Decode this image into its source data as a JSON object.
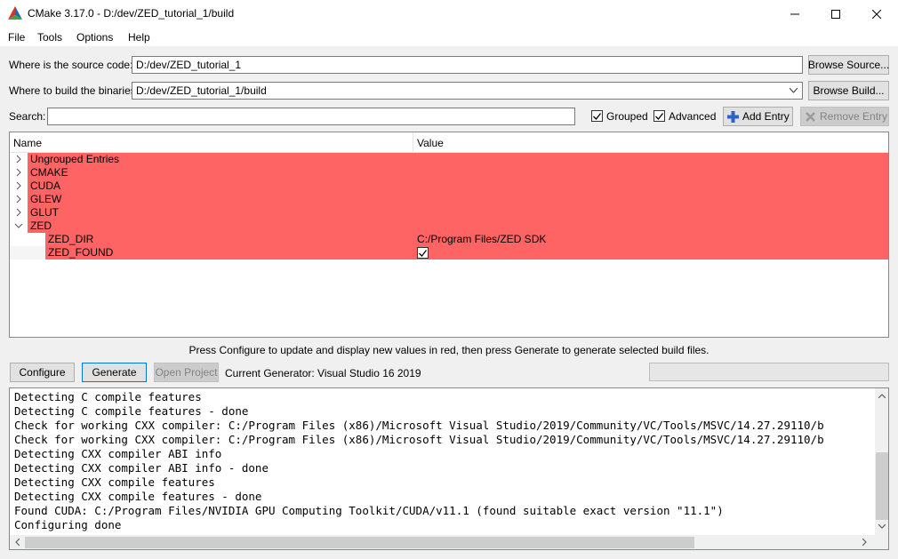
{
  "window": {
    "title": "CMake 3.17.0 - D:/dev/ZED_tutorial_1/build"
  },
  "menu": [
    "File",
    "Tools",
    "Options",
    "Help"
  ],
  "source": {
    "label": "Where is the source code:",
    "value": "D:/dev/ZED_tutorial_1",
    "browse": "Browse Source..."
  },
  "build": {
    "label": "Where to build the binaries:",
    "value": "D:/dev/ZED_tutorial_1/build",
    "browse": "Browse Build..."
  },
  "search": {
    "label": "Search:",
    "value": "",
    "grouped": "Grouped",
    "advanced": "Advanced",
    "add_entry": "Add Entry",
    "remove_entry": "Remove Entry"
  },
  "tree": {
    "col_name": "Name",
    "col_value": "Value",
    "groups": [
      "Ungrouped Entries",
      "CMAKE",
      "CUDA",
      "GLEW",
      "GLUT",
      "ZED"
    ],
    "zed_children": [
      {
        "name": "ZED_DIR",
        "value": "C:/Program Files/ZED SDK"
      },
      {
        "name": "ZED_FOUND",
        "value": ""
      }
    ]
  },
  "hint": "Press Configure to update and display new values in red, then press Generate to generate selected build files.",
  "actions": {
    "configure": "Configure",
    "generate": "Generate",
    "open_project": "Open Project",
    "generator": "Current Generator: Visual Studio 16 2019"
  },
  "output": [
    "Detecting C compile features",
    "Detecting C compile features - done",
    "Check for working CXX compiler: C:/Program Files (x86)/Microsoft Visual Studio/2019/Community/VC/Tools/MSVC/14.27.29110/b",
    "Check for working CXX compiler: C:/Program Files (x86)/Microsoft Visual Studio/2019/Community/VC/Tools/MSVC/14.27.29110/b",
    "Detecting CXX compiler ABI info",
    "Detecting CXX compiler ABI info - done",
    "Detecting CXX compile features",
    "Detecting CXX compile features - done",
    "Found CUDA: C:/Program Files/NVIDIA GPU Computing Toolkit/CUDA/v11.1 (found suitable exact version \"11.1\")",
    "Configuring done"
  ],
  "colors": {
    "changed_row": "#ff6464",
    "focus_blue": "#0078d7"
  }
}
